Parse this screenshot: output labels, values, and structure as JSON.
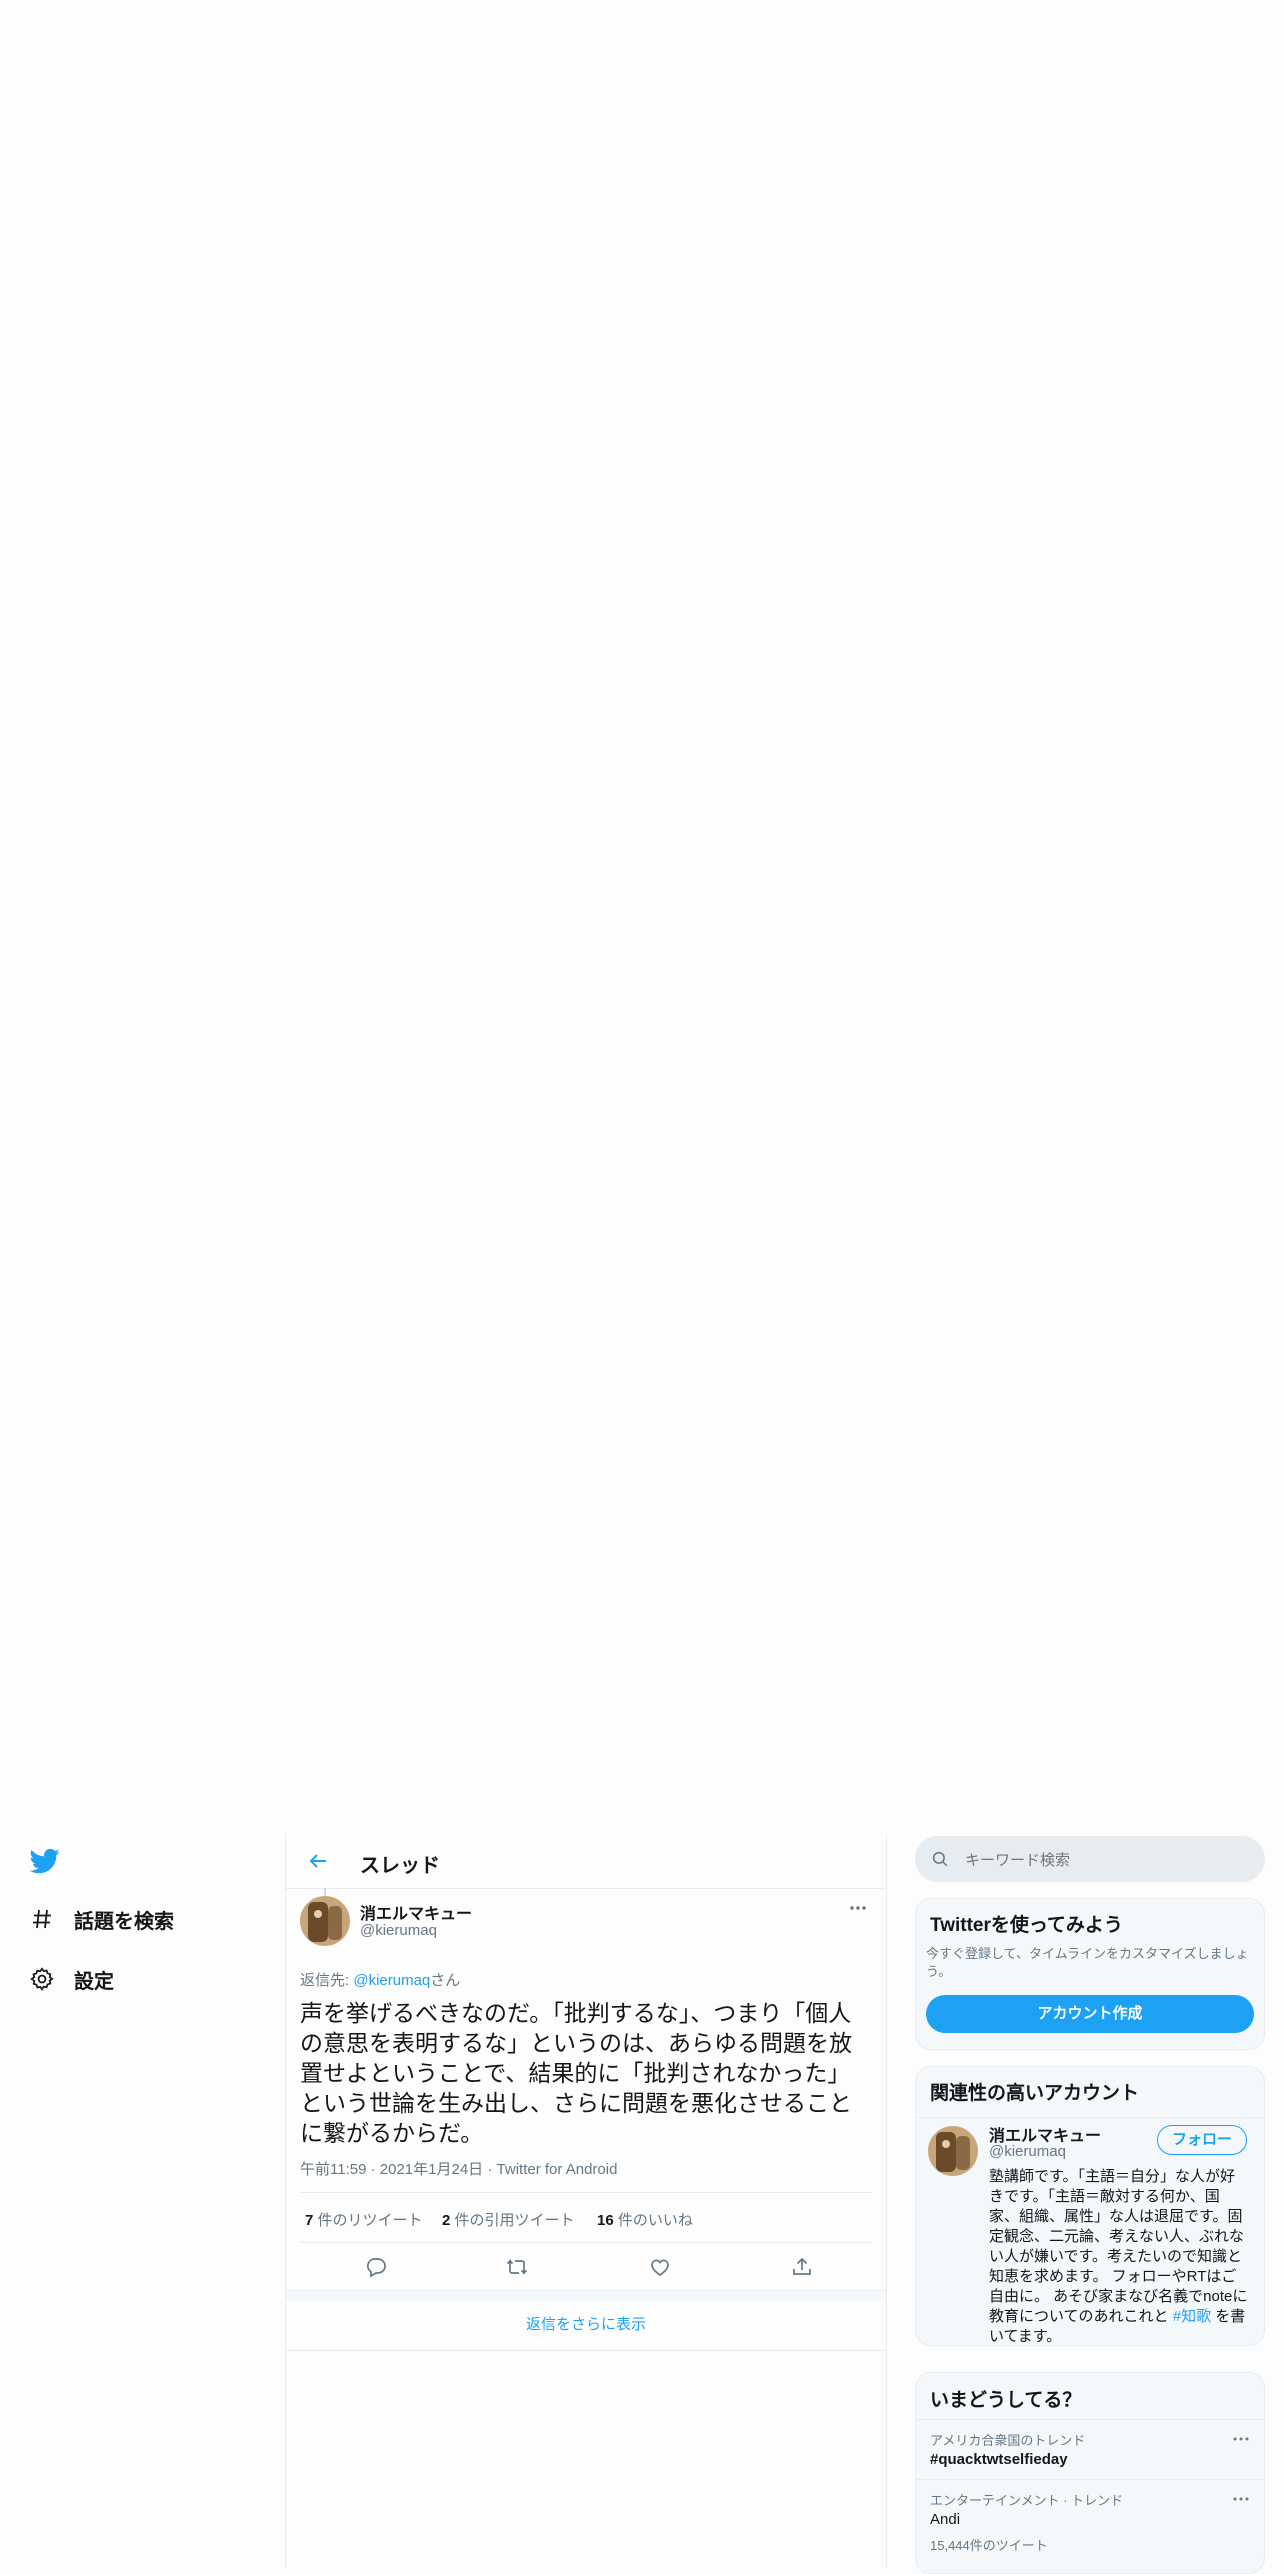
{
  "colors": {
    "accent": "#1da1f2",
    "text": "#14171a",
    "muted": "#657786",
    "border": "#e6ecf0"
  },
  "left_nav": {
    "logo_icon": "twitter-bird-icon",
    "items": [
      {
        "icon": "hashtag-icon",
        "label": "話題を検索"
      },
      {
        "icon": "gear-icon",
        "label": "設定"
      }
    ]
  },
  "header": {
    "back_icon": "arrow-left-icon",
    "title": "スレッド"
  },
  "tweet": {
    "author_name": "消エルマキュー",
    "author_handle": "@kierumaq",
    "more_icon": "more-icon",
    "reply_prefix": "返信先: ",
    "reply_handle": "@kierumaq",
    "reply_suffix": "さん",
    "text": "声を挙げるべきなのだ。「批判するな」、つまり「個人の意思を表明するな」というのは、あらゆる問題を放置せよということで、結果的に「批判されなかった」という世論を生み出し、さらに問題を悪化させることに繋がるからだ。",
    "time": "午前11:59",
    "sep1": "·",
    "date": "2021年1月24日",
    "sep2": "·",
    "source": "Twitter for Android",
    "stats": {
      "retweets_count": "7",
      "retweets_label": " 件のリツイート",
      "quotes_count": "2",
      "quotes_label": " 件の引用ツイート",
      "likes_count": "16",
      "likes_label": " 件のいいね"
    },
    "actions": [
      "reply-icon",
      "retweet-icon",
      "like-icon",
      "share-icon"
    ]
  },
  "show_more_replies": "返信をさらに表示",
  "search": {
    "icon": "search-icon",
    "placeholder": "キーワード検索"
  },
  "signup_card": {
    "title": "Twitterを使ってみよう",
    "description": "今すぐ登録して、タイムラインをカスタマイズしましょう。",
    "button": "アカウント作成"
  },
  "related_card": {
    "title": "関連性の高いアカウント",
    "name": "消エルマキュー",
    "handle": "@kierumaq",
    "follow_button": "フォロー",
    "bio_lines": [
      "塾講師です。「主語＝自分」な人が好",
      "きです。「主語＝敵対する何か、国",
      "家、組織、属性」な人は退屈です。固",
      "定観念、二元論、考えない人、ぶれな",
      "い人が嫌いです。考えたいので知識と",
      "知恵を求めます。 フォローやRTはご",
      "自由に。 あそび家まなび名義でnoteに"
    ],
    "bio_last_prefix": "教育についてのあれこれと ",
    "bio_hashtag": "#知歌",
    "bio_last_suffix": " を書",
    "bio_end": "いてます。"
  },
  "trends_card": {
    "title": "いまどうしてる？",
    "items": [
      {
        "context": "アメリカ合衆国のトレンド",
        "name": "#quacktwtselfieday",
        "count": ""
      },
      {
        "context": "エンターテインメント · トレンド",
        "name": "Andi",
        "count": "15,444件のツイート"
      }
    ]
  }
}
